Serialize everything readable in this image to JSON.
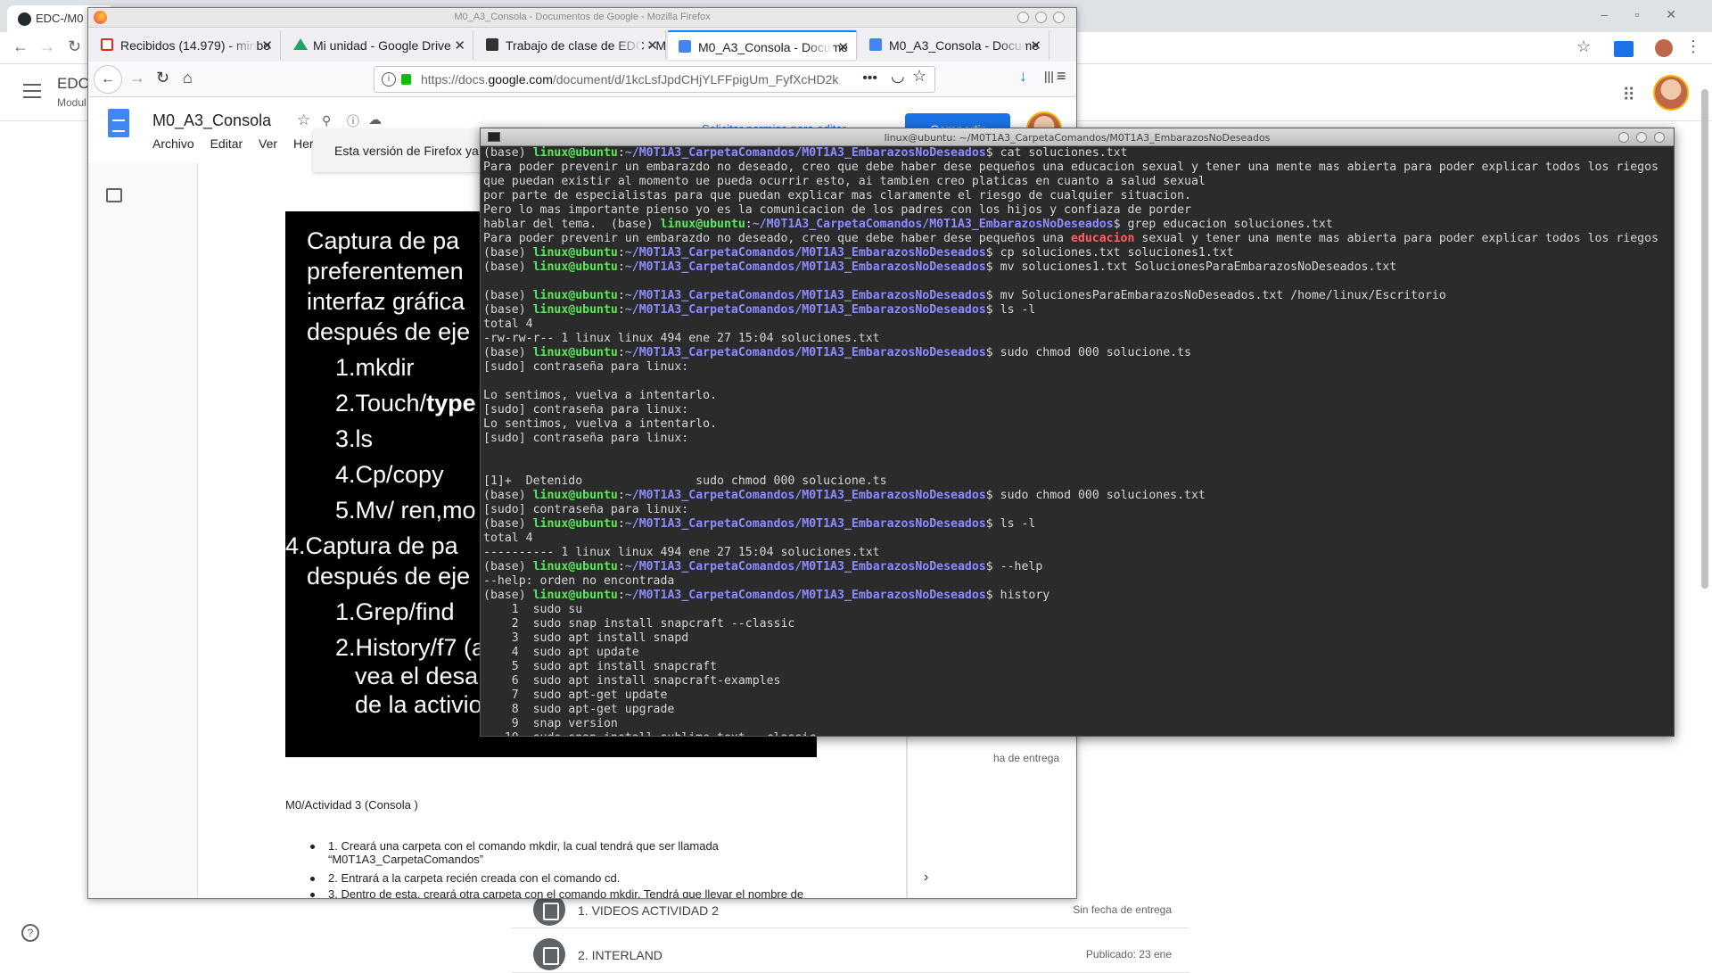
{
  "bg": {
    "tab_label": "EDC-/M0",
    "course_name": "EDC",
    "course_sub": "Modul",
    "rows": [
      {
        "title": "1. VIDEOS ACTIVIDAD 2",
        "due": "Sin fecha de entrega"
      },
      {
        "title": "2. INTERLAND",
        "due": "Publicado: 23 ene"
      }
    ],
    "side_due": "ha de entrega"
  },
  "firefox": {
    "window_title": "M0_A3_Consola - Documentos de Google - Mozilla Firefox",
    "tabs": [
      {
        "label": "Recibidos (14.979) - minbo",
        "icon": "gmail-icon",
        "color": "#d93025"
      },
      {
        "label": "Mi unidad - Google Drive",
        "icon": "drive-icon",
        "color": "#1fa463"
      },
      {
        "label": "Trabajo de clase de EDC - M",
        "icon": "classroom-icon",
        "color": "#333333"
      },
      {
        "label": "M0_A3_Consola - Docume",
        "icon": "docs-icon",
        "color": "#4285f4"
      },
      {
        "label": "M0_A3_Consola - Docume",
        "icon": "docs-icon",
        "color": "#4285f4"
      }
    ],
    "url_prefix": "https://docs.",
    "url_domain": "google.com",
    "url_rest": "/document/d/1kcLsfJpdCHjYLFFpigUm_FyfXcHD2k",
    "notice": "Esta versión de Firefox ya"
  },
  "docs": {
    "title": "M0_A3_Consola",
    "menu": [
      "Archivo",
      "Editar",
      "Ver",
      "Herra"
    ],
    "share": "Compartir",
    "permission": "Solicitar permiso para editar",
    "slide_lines": [
      "Captura de pa",
      "preferentemen",
      "interfaz gráfica",
      "después de eje",
      "1.mkdir",
      "2.Touch/",
      "type",
      "3.ls",
      "4.Cp/copy",
      "5.Mv/ ren,mo",
      "4.Captura de pa",
      "después de eje",
      "1.Grep/find",
      "2.History/f7 (a",
      "vea el desa",
      "de la activio"
    ],
    "heading": "M0/Actividad 3 (Consola )",
    "list": [
      "1. Creará una carpeta con el comando mkdir, la cual tendrá que ser llamada “M0T1A3_CarpetaComandos”",
      "2. Entrará a la carpeta recién creada con el comando cd.",
      "3. Dentro de esta, creará otra carpeta con el comando mkdir. Tendrá que llevar el nombre de"
    ]
  },
  "terminal": {
    "title": "linux@ubuntu: ~/M0T1A3_CarpetaComandos/M0T1A3_EmbarazosNoDeseados",
    "env": "(base) ",
    "user": "linux@ubuntu",
    "path": "~/M0T1A3_CarpetaComandos/M0T1A3_EmbarazosNoDeseados",
    "lines": [
      {
        "t": "p",
        "cmd": "cat soluciones.txt"
      },
      {
        "t": "o",
        "text": "Para poder prevenir un embarazdo no deseado, creo que debe haber dese pequeños una educacion sexual y tener una mente mas abierta para poder explicar todos los riegos"
      },
      {
        "t": "o",
        "text": "que puedan existir al momento ue pueda ocurrir esto, ai tambien creo platicas en cuanto a salud sexual"
      },
      {
        "t": "o",
        "text": "por parte de especialistas para que puedan explicar mas claramente el riesgo de cualquier situacion."
      },
      {
        "t": "o",
        "text": "Pero lo mas importante pienso yo es la comunicacion de los padres con los hijos y confiaza de porder"
      },
      {
        "t": "m",
        "pre": "hablar del tema.  (base) ",
        "cmd": "grep educacion soluciones.txt"
      },
      {
        "t": "h",
        "a": "Para poder prevenir un embarazdo no deseado, creo que debe haber dese pequeños una ",
        "b": "educacion",
        "c": " sexual y tener una mente mas abierta para poder explicar todos los riegos"
      },
      {
        "t": "p",
        "cmd": "cp soluciones.txt soluciones1.txt"
      },
      {
        "t": "p",
        "cmd": "mv soluciones1.txt SolucionesParaEmbarazosNoDeseados.txt"
      },
      {
        "t": "o",
        "text": ""
      },
      {
        "t": "p",
        "cmd": "mv SolucionesParaEmbarazosNoDeseados.txt /home/linux/Escritorio"
      },
      {
        "t": "p",
        "cmd": "ls -l"
      },
      {
        "t": "o",
        "text": "total 4"
      },
      {
        "t": "o",
        "text": "-rw-rw-r-- 1 linux linux 494 ene 27 15:04 soluciones.txt"
      },
      {
        "t": "p",
        "cmd": "sudo chmod 000 solucione.ts"
      },
      {
        "t": "o",
        "text": "[sudo] contraseña para linux:"
      },
      {
        "t": "o",
        "text": ""
      },
      {
        "t": "o",
        "text": "Lo sentimos, vuelva a intentarlo."
      },
      {
        "t": "o",
        "text": "[sudo] contraseña para linux:"
      },
      {
        "t": "o",
        "text": "Lo sentimos, vuelva a intentarlo."
      },
      {
        "t": "o",
        "text": "[sudo] contraseña para linux:"
      },
      {
        "t": "o",
        "text": ""
      },
      {
        "t": "o",
        "text": ""
      },
      {
        "t": "o",
        "text": "[1]+  Detenido                sudo chmod 000 solucione.ts"
      },
      {
        "t": "p",
        "cmd": "sudo chmod 000 soluciones.txt"
      },
      {
        "t": "o",
        "text": "[sudo] contraseña para linux:"
      },
      {
        "t": "p",
        "cmd": "ls -l"
      },
      {
        "t": "o",
        "text": "total 4"
      },
      {
        "t": "o",
        "text": "---------- 1 linux linux 494 ene 27 15:04 soluciones.txt"
      },
      {
        "t": "p",
        "cmd": "--help"
      },
      {
        "t": "o",
        "text": "--help: orden no encontrada"
      },
      {
        "t": "p",
        "cmd": "history"
      },
      {
        "t": "o",
        "text": "    1  sudo su"
      },
      {
        "t": "o",
        "text": "    2  sudo snap install snapcraft --classic"
      },
      {
        "t": "o",
        "text": "    3  sudo apt install snapd"
      },
      {
        "t": "o",
        "text": "    4  sudo apt update"
      },
      {
        "t": "o",
        "text": "    5  sudo apt install snapcraft"
      },
      {
        "t": "o",
        "text": "    6  sudo apt install snapcraft-examples"
      },
      {
        "t": "o",
        "text": "    7  sudo apt-get update"
      },
      {
        "t": "o",
        "text": "    8  sudo apt-get upgrade"
      },
      {
        "t": "o",
        "text": "    9  snap version"
      },
      {
        "t": "o",
        "text": "   10  sudo snap install sublime-text --classic"
      }
    ]
  }
}
